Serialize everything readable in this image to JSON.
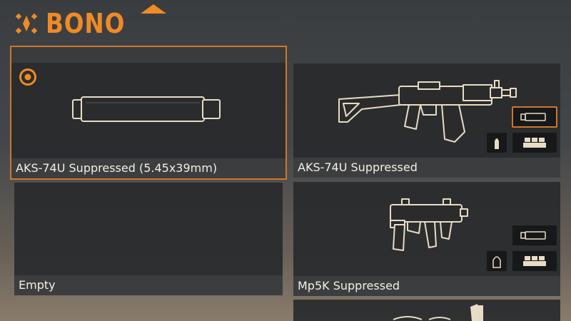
{
  "header": {
    "title": "BONO",
    "logo_icon": "bono-emblem-icon"
  },
  "accent_color": "#f08a24",
  "cards": {
    "suppressor": {
      "label": "AKS-74U Suppressed (5.45x39mm)",
      "icon": "suppressor-icon",
      "selected": true
    },
    "empty": {
      "label": "Empty"
    },
    "aks": {
      "label": "AKS-74U Suppressed",
      "icon": "aks74u-rifle-icon"
    },
    "mp5": {
      "label": "Mp5K Suppressed",
      "icon": "mp5k-smg-icon"
    }
  }
}
